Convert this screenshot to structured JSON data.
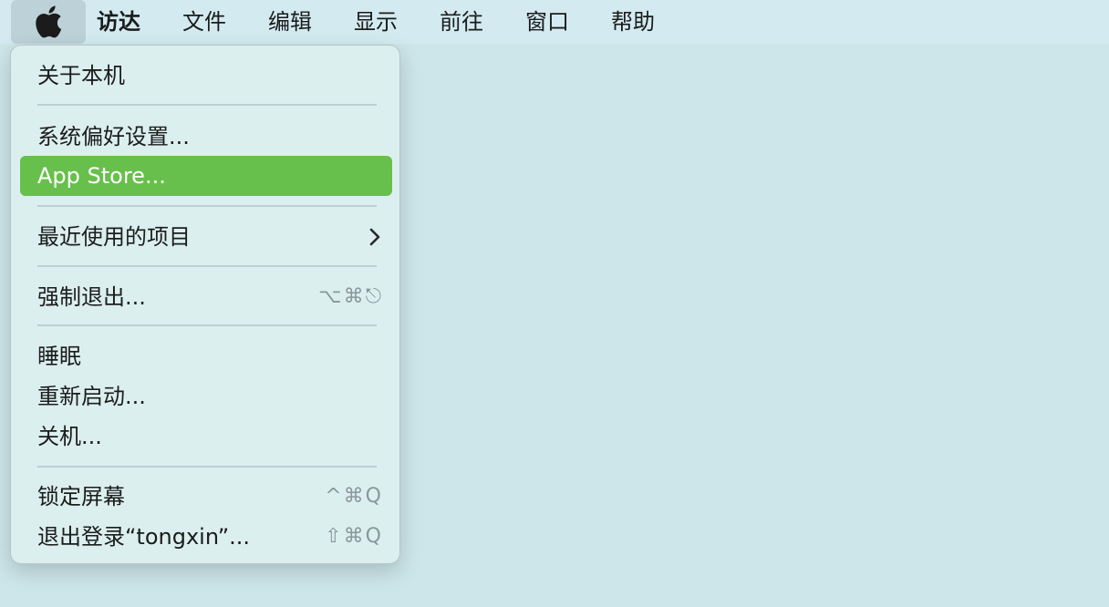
{
  "menubar": {
    "apple_icon": "apple-logo-icon",
    "items": [
      {
        "label": "访达"
      },
      {
        "label": "文件"
      },
      {
        "label": "编辑"
      },
      {
        "label": "显示"
      },
      {
        "label": "前往"
      },
      {
        "label": "窗口"
      },
      {
        "label": "帮助"
      }
    ]
  },
  "apple_menu": {
    "items": [
      {
        "label": "关于本机"
      },
      {
        "label": "系统偏好设置..."
      },
      {
        "label": "App Store...",
        "highlighted": true
      },
      {
        "label": "最近使用的项目",
        "submenu_icon": "chevron-right-icon"
      },
      {
        "label": "强制退出...",
        "shortcut": "⌥⌘⎋"
      },
      {
        "label": "睡眠"
      },
      {
        "label": "重新启动..."
      },
      {
        "label": "关机..."
      },
      {
        "label": "锁定屏幕",
        "shortcut": "^⌘Q"
      },
      {
        "label": "退出登录“tongxin”...",
        "shortcut": "⇧⌘Q"
      }
    ]
  },
  "colors": {
    "desktop": "#cde6ea",
    "menubar": "#d3ebf0",
    "menu_bg": "#dcefef",
    "highlight": "#67c04b"
  }
}
